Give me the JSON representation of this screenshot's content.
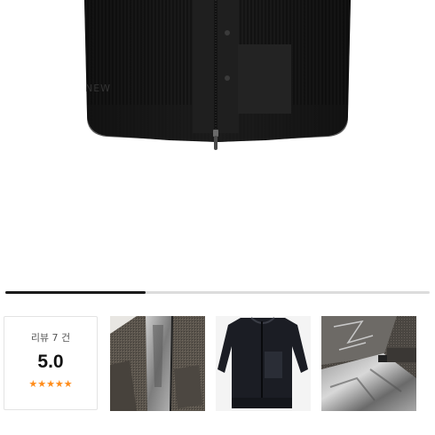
{
  "gallery": {
    "progress_fraction": 0.33
  },
  "review": {
    "count_label": "리뷰 7 건",
    "score": "5.0",
    "stars": "★★★★★",
    "star_color": "#ff8c1a"
  },
  "hero_image": {
    "brand_text": "NEW"
  },
  "thumbnails": [
    {
      "icon": "photo-jacket-lining"
    },
    {
      "icon": "photo-jacket-folded"
    },
    {
      "icon": "photo-jacket-pattern"
    }
  ]
}
